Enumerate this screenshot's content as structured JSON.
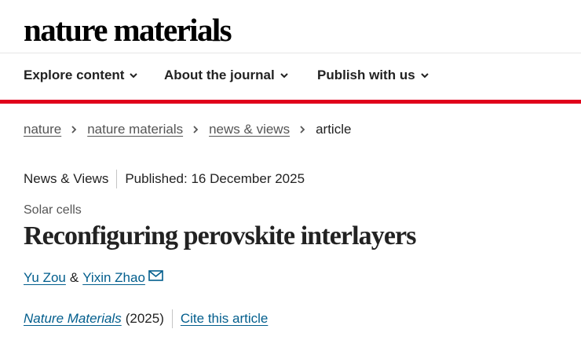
{
  "masthead": {
    "logo_text": "nature materials"
  },
  "nav": {
    "items": [
      {
        "label": "Explore content"
      },
      {
        "label": "About the journal"
      },
      {
        "label": "Publish with us"
      }
    ],
    "accent_color": "#e0001b"
  },
  "breadcrumb": {
    "items": [
      {
        "label": "nature"
      },
      {
        "label": "nature materials"
      },
      {
        "label": "news & views"
      },
      {
        "label": "article"
      }
    ]
  },
  "article": {
    "type": "News & Views",
    "published": "Published: 16 December 2025",
    "subject": "Solar cells",
    "title": "Reconfiguring perovskite interlayers",
    "authors": [
      {
        "name": "Yu Zou"
      },
      {
        "name": "Yixin Zhao"
      }
    ],
    "author_separator": "&",
    "journal": "Nature Materials",
    "year": "(2025)",
    "cite_label": "Cite this article",
    "link_color": "#025e8d"
  },
  "icons": {
    "nav_chevron": "chevron-down-icon",
    "breadcrumb_separator": "chevron-right-icon",
    "corresponding_author": "mail-icon"
  }
}
